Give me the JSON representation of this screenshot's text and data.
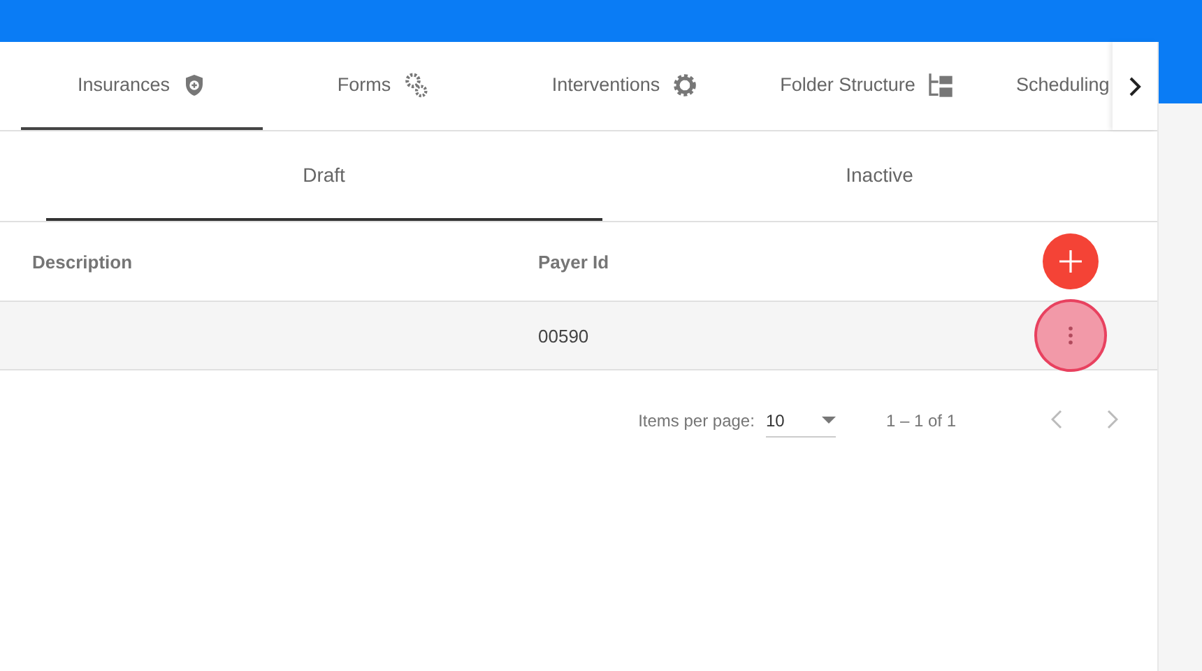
{
  "tabs": [
    {
      "label": "Insurances",
      "selected": true
    },
    {
      "label": "Forms",
      "selected": false
    },
    {
      "label": "Interventions",
      "selected": false
    },
    {
      "label": "Folder Structure",
      "selected": false
    },
    {
      "label": "Scheduling",
      "selected": false
    }
  ],
  "subtabs": [
    {
      "label": "Draft",
      "selected": true
    },
    {
      "label": "Inactive",
      "selected": false
    }
  ],
  "table": {
    "columns": [
      "Description",
      "Payer Id"
    ],
    "rows": [
      {
        "payer_id": "00590"
      }
    ]
  },
  "paginator": {
    "label": "Items per page:",
    "page_size": "10",
    "range": "1 – 1 of 1",
    "prev_disabled": true,
    "next_disabled": true
  }
}
